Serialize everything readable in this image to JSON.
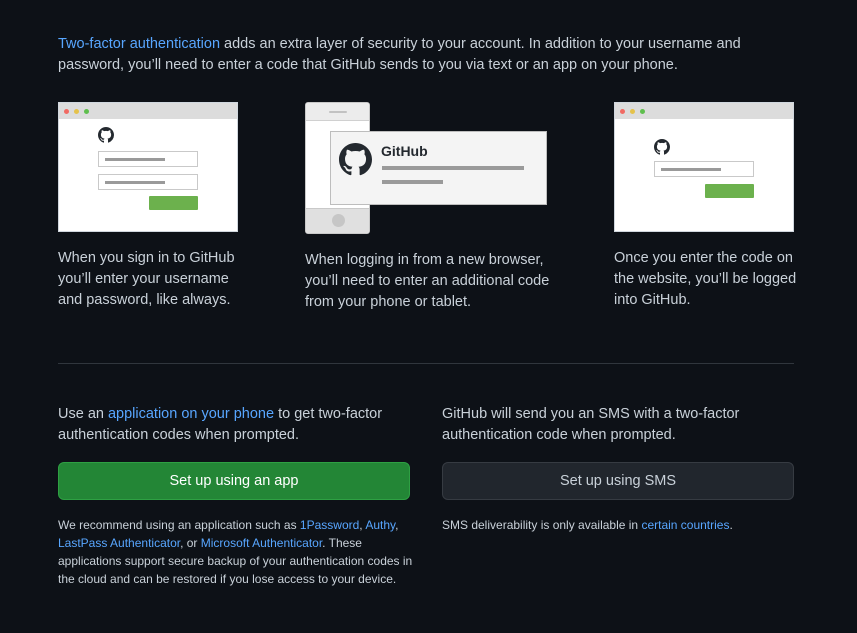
{
  "intro": {
    "link": "Two-factor authentication",
    "text": " adds an extra layer of security to your account. In addition to your username and password, you’ll need to enter a code that GitHub sends to you via text or an app on your phone."
  },
  "illustrations": {
    "brand": "GitHub"
  },
  "steps": [
    {
      "caption": "When you sign in to GitHub you’ll enter your username and password, like always."
    },
    {
      "caption": "When logging in from a new browser, you’ll need to enter an additional code from your phone or tablet."
    },
    {
      "caption": "Once you enter the code on the website, you’ll be logged into GitHub."
    }
  ],
  "app_option": {
    "text_before": "Use an ",
    "link": "application on your phone",
    "text_after": " to get two-factor authentication codes when prompted.",
    "button_label": "Set up using an app",
    "note_before": "We recommend using an application such as ",
    "apps": [
      "1Password",
      "Authy",
      "LastPass Authenticator",
      "Microsoft Authenticator"
    ],
    "sep1": ", ",
    "sep2": ", ",
    "sep3": ", or ",
    "note_after": ". These applications support secure backup of your authentication codes in the cloud and can be restored if you lose access to your device."
  },
  "sms_option": {
    "text": "GitHub will send you an SMS with a two-factor authentication code when prompted.",
    "button_label": "Set up using SMS",
    "note_before": "SMS deliverability is only available in ",
    "link": "certain countries",
    "note_after": "."
  },
  "colors": {
    "background": "#0d1117",
    "link": "#58a6ff",
    "primary_button": "#238636",
    "secondary_button": "#21262d"
  }
}
